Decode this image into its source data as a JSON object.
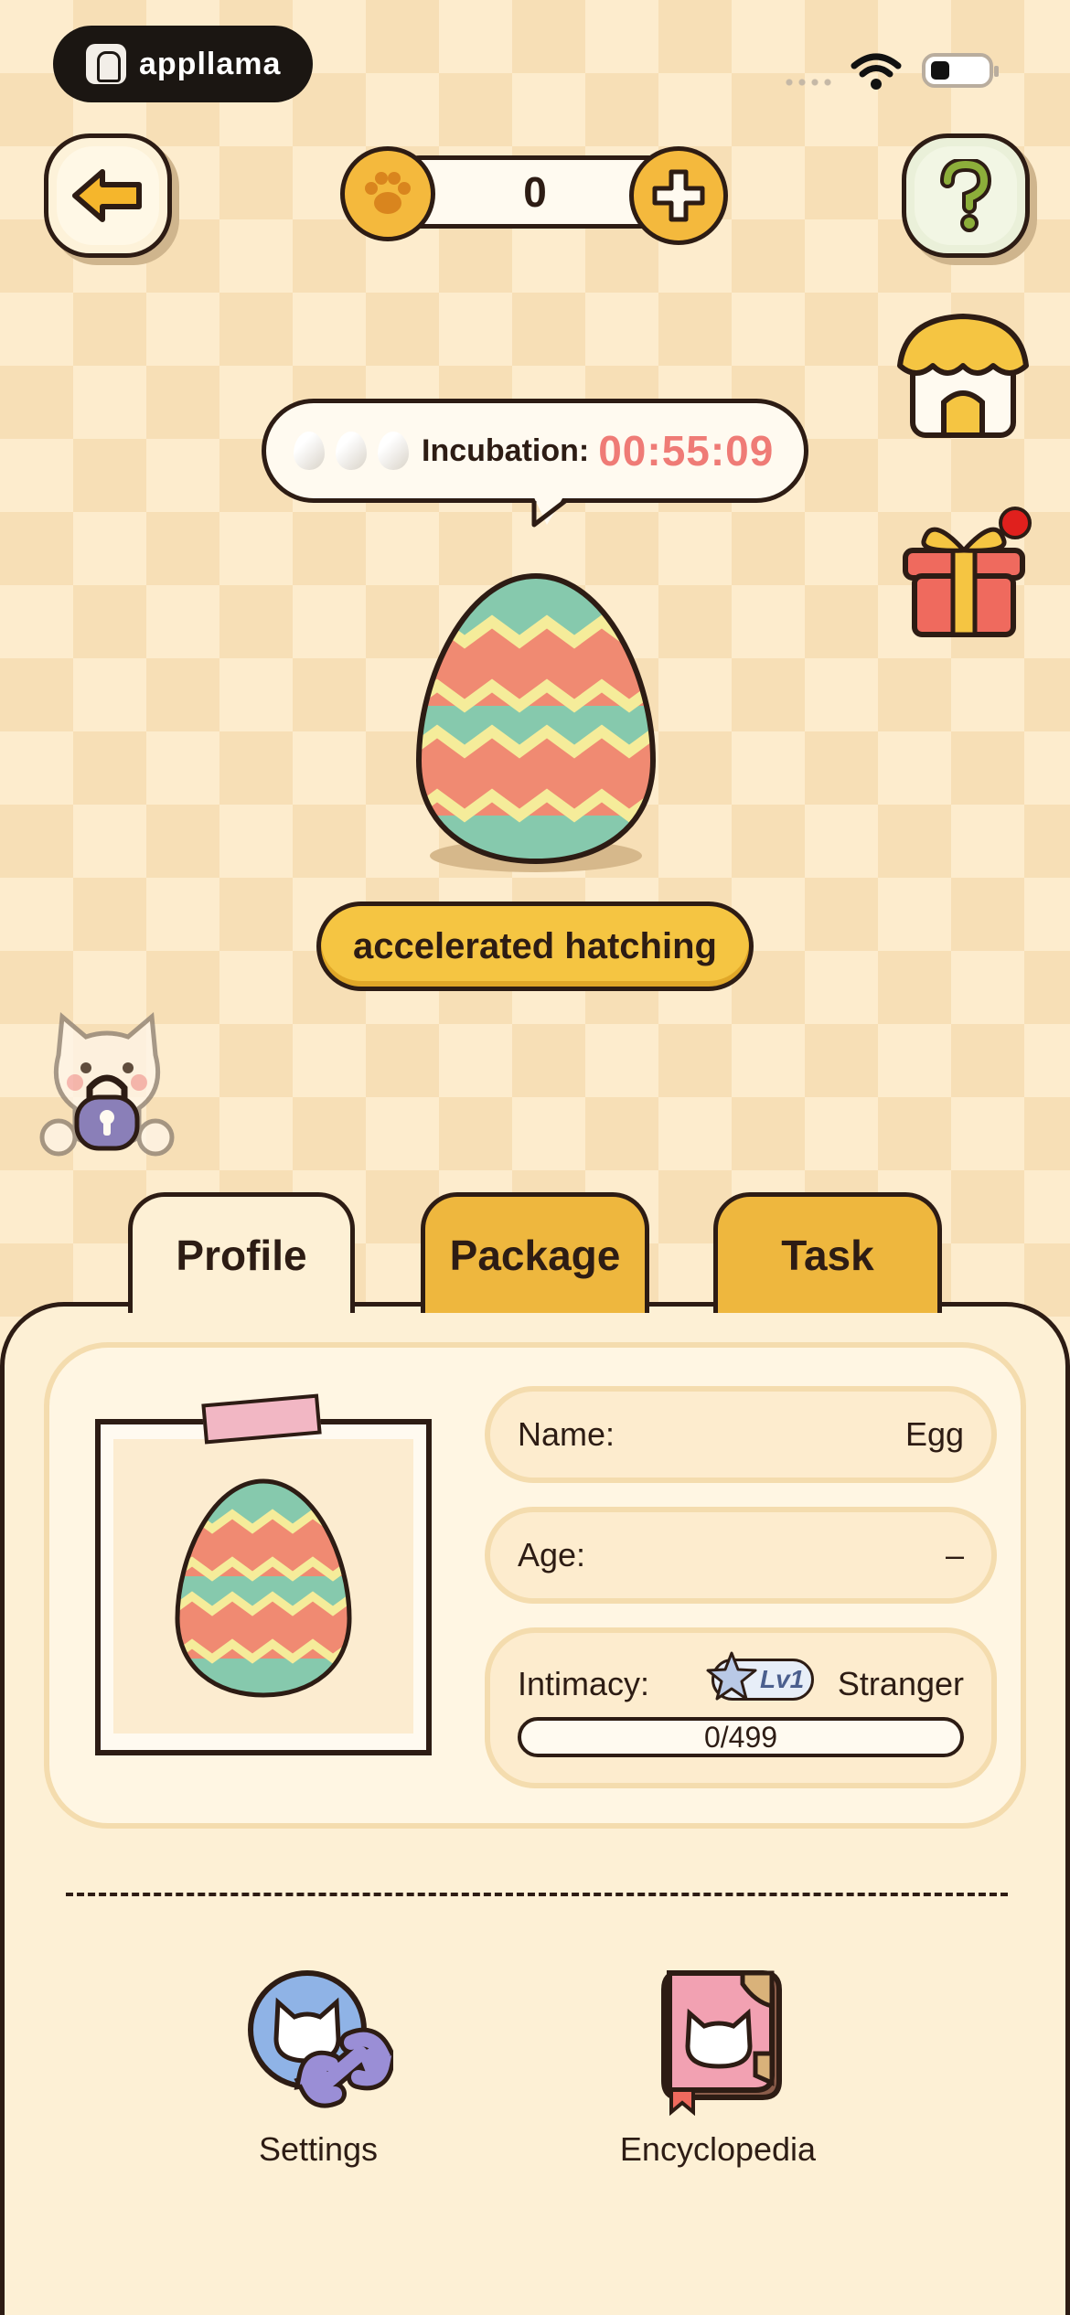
{
  "status_bar": {
    "app_name": "appllama",
    "wifi_icon": "wifi-icon",
    "battery_icon": "battery-icon"
  },
  "header": {
    "back_icon": "arrow-left-icon",
    "coins": "0",
    "paw_icon": "paw-icon",
    "add_icon": "plus-icon",
    "help_icon": "question-icon"
  },
  "side": {
    "house_icon": "house-icon",
    "gift_icon": "gift-icon",
    "gift_has_notification": true,
    "lock_cat_icon": "locked-cat-icon"
  },
  "incubation": {
    "label": "Incubation:",
    "time": "00:55:09",
    "mini_eggs": 3
  },
  "main_egg": {
    "icon": "striped-egg-icon"
  },
  "accelerate_button": "accelerated hatching",
  "tabs": [
    {
      "label": "Profile",
      "active": true
    },
    {
      "label": "Package",
      "active": false
    },
    {
      "label": "Task",
      "active": false
    }
  ],
  "profile": {
    "name_label": "Name:",
    "name_value": "Egg",
    "age_label": "Age:",
    "age_value": "–",
    "intimacy_label": "Intimacy:",
    "level": "Lv1",
    "level_title": "Stranger",
    "progress_text": "0/499",
    "progress_fraction": 0
  },
  "bottom_menu": [
    {
      "label": "Settings",
      "icon": "settings-cat-icon"
    },
    {
      "label": "Encyclopedia",
      "icon": "encyclopedia-book-icon"
    }
  ],
  "colors": {
    "accent_yellow": "#f5c542",
    "timer_red": "#ef7b76",
    "outline": "#2d1c14",
    "panel": "#fdf0d5"
  }
}
